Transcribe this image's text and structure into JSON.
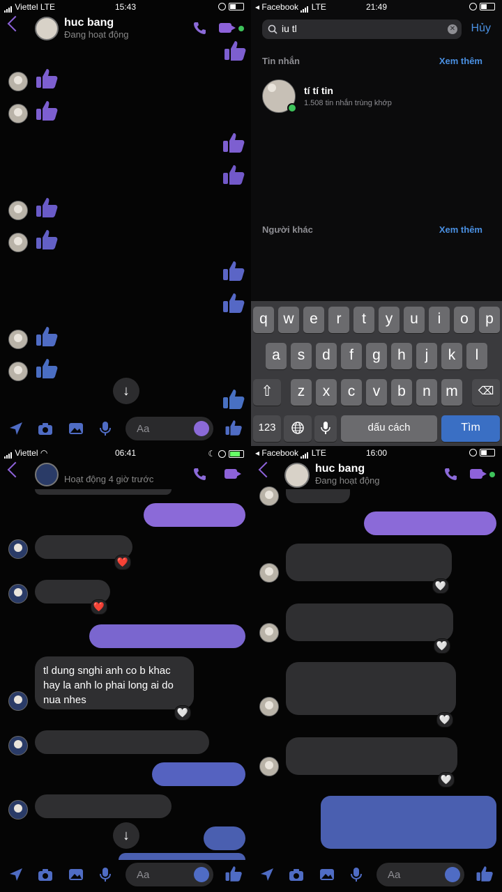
{
  "panel1": {
    "status": {
      "carrier": "Viettel",
      "network": "LTE",
      "time": "15:43"
    },
    "header": {
      "name": "huc bang",
      "status": "Đang hoạt động"
    },
    "composer": {
      "placeholder": "Aa"
    },
    "icons": [
      "back-icon",
      "phone-icon",
      "video-icon",
      "thumbs-up-icon",
      "location-icon",
      "camera-icon",
      "image-icon",
      "mic-icon",
      "emoji-icon",
      "chevron-down-icon"
    ],
    "colors": {
      "accent": "#8b6ad8",
      "thumb_purple": "#7d5fd0",
      "thumb_blue": "#4f6cc4"
    }
  },
  "panel2": {
    "status": {
      "carrier": "Facebook",
      "network": "LTE",
      "time": "21:49"
    },
    "search": {
      "query": "iu tl",
      "cancel": "Hủy"
    },
    "messages_section": {
      "title": "Tin nhắn",
      "more": "Xem thêm"
    },
    "result": {
      "name": "tí tí tin",
      "detail": "1.508 tin nhắn trùng khớp"
    },
    "others_section": {
      "title": "Người khác",
      "more": "Xem thêm"
    },
    "keyboard": {
      "row1": [
        "q",
        "w",
        "e",
        "r",
        "t",
        "y",
        "u",
        "i",
        "o",
        "p"
      ],
      "row2": [
        "a",
        "s",
        "d",
        "f",
        "g",
        "h",
        "j",
        "k",
        "l"
      ],
      "row3": [
        "z",
        "x",
        "c",
        "v",
        "b",
        "n",
        "m"
      ],
      "numbers": "123",
      "space": "dấu cách",
      "go": "Tìm"
    }
  },
  "panel3": {
    "status": {
      "carrier": "Viettel",
      "time": "06:41"
    },
    "header": {
      "status": "Hoạt động 4 giờ trước"
    },
    "message": {
      "text": "tl dung snghi anh co b khac hay la anh lo phai long ai do nua nhes"
    },
    "composer": {
      "placeholder": "Aa"
    }
  },
  "panel4": {
    "status": {
      "carrier": "Facebook",
      "network": "LTE",
      "time": "16:00"
    },
    "header": {
      "name": "huc bang",
      "status": "Đang hoạt động"
    },
    "composer": {
      "placeholder": "Aa"
    }
  }
}
